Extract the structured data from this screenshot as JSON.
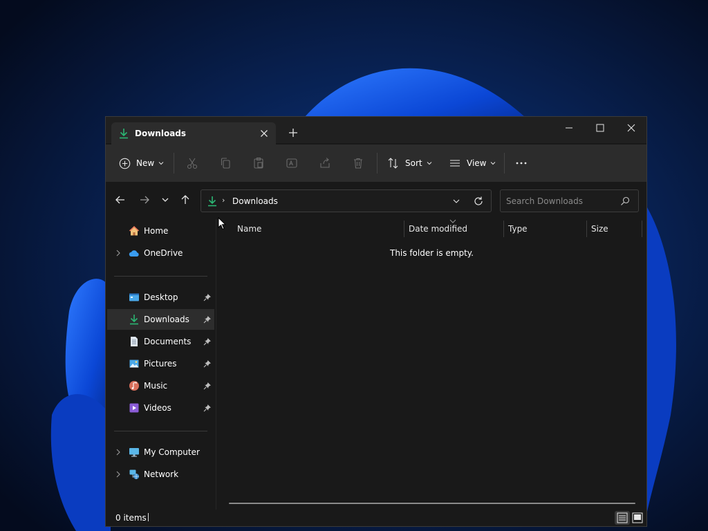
{
  "window": {
    "tab_title": "Downloads",
    "controls": {
      "minimize": "minimize-icon",
      "maximize": "maximize-icon",
      "close": "close-icon"
    }
  },
  "commandbar": {
    "new_label": "New",
    "sort_label": "Sort",
    "view_label": "View",
    "icons": [
      "cut-icon",
      "copy-icon",
      "paste-icon",
      "rename-icon",
      "share-icon",
      "delete-icon",
      "more-icon"
    ]
  },
  "navigation": {
    "address_text": "Downloads",
    "address_separator": "›",
    "search_placeholder": "Search Downloads"
  },
  "sidebar": {
    "items": [
      {
        "label": "Home",
        "icon": "home-icon",
        "expandable": false,
        "pinned": false
      },
      {
        "label": "OneDrive",
        "icon": "cloud-icon",
        "expandable": true,
        "pinned": false
      },
      {
        "label": "Desktop",
        "icon": "desktop-icon",
        "expandable": false,
        "pinned": true
      },
      {
        "label": "Downloads",
        "icon": "download-icon",
        "expandable": false,
        "pinned": true,
        "selected": true
      },
      {
        "label": "Documents",
        "icon": "document-icon",
        "expandable": false,
        "pinned": true
      },
      {
        "label": "Pictures",
        "icon": "pictures-icon",
        "expandable": false,
        "pinned": true
      },
      {
        "label": "Music",
        "icon": "music-icon",
        "expandable": false,
        "pinned": true
      },
      {
        "label": "Videos",
        "icon": "videos-icon",
        "expandable": false,
        "pinned": true
      },
      {
        "label": "My Computer",
        "icon": "computer-icon",
        "expandable": true,
        "pinned": false
      },
      {
        "label": "Network",
        "icon": "network-icon",
        "expandable": true,
        "pinned": false
      }
    ]
  },
  "content": {
    "columns": [
      "Name",
      "Date modified",
      "Type",
      "Size"
    ],
    "empty_message": "This folder is empty."
  },
  "status": {
    "item_count": "0 items"
  },
  "colors": {
    "window_bg": "#191919",
    "titlebar_bg": "#202020",
    "commandbar_bg": "#2c2c2c",
    "accent_green": "#2bb673",
    "selected_bg": "#2d2d2d"
  }
}
